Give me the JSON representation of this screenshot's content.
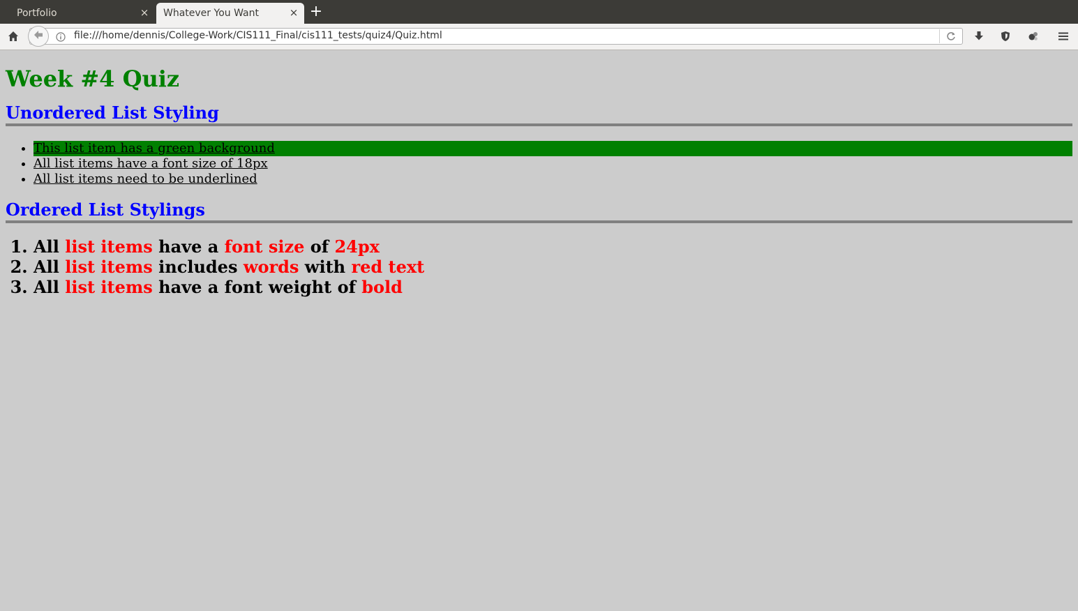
{
  "browser": {
    "tabs": [
      {
        "label": "Portfolio",
        "active": false
      },
      {
        "label": "Whatever You Want",
        "active": true
      }
    ],
    "new_tab_label": "+",
    "close_glyph": "×",
    "url": "file:///home/dennis/College-Work/CIS111_Final/cis111_tests/quiz4/Quiz.html",
    "icons": [
      "home-icon",
      "back-arrow-icon",
      "info-icon",
      "reload-icon",
      "download-icon",
      "shield-icon",
      "extension-icon",
      "menu-icon"
    ]
  },
  "page": {
    "title": "Week #4 Quiz",
    "title_color": "#008000",
    "heading_color": "#0000ff",
    "highlight_color": "#ff0000",
    "unordered_section": {
      "heading": "Unordered List Styling",
      "items": [
        "This list item has a green background",
        "All list items have a font size of 18px",
        "All list items need to be underlined"
      ]
    },
    "ordered_section": {
      "heading": "Ordered List Stylings",
      "items": [
        [
          {
            "text": "All ",
            "red": false
          },
          {
            "text": "list items",
            "red": true
          },
          {
            "text": " have a ",
            "red": false
          },
          {
            "text": "font size",
            "red": true
          },
          {
            "text": " of ",
            "red": false
          },
          {
            "text": "24px",
            "red": true
          }
        ],
        [
          {
            "text": "All ",
            "red": false
          },
          {
            "text": "list items",
            "red": true
          },
          {
            "text": " includes ",
            "red": false
          },
          {
            "text": "words",
            "red": true
          },
          {
            "text": " with ",
            "red": false
          },
          {
            "text": "red text",
            "red": true
          }
        ],
        [
          {
            "text": "All ",
            "red": false
          },
          {
            "text": "list items",
            "red": true
          },
          {
            "text": " have a font weight of ",
            "red": false
          },
          {
            "text": "bold",
            "red": true
          }
        ]
      ]
    }
  }
}
